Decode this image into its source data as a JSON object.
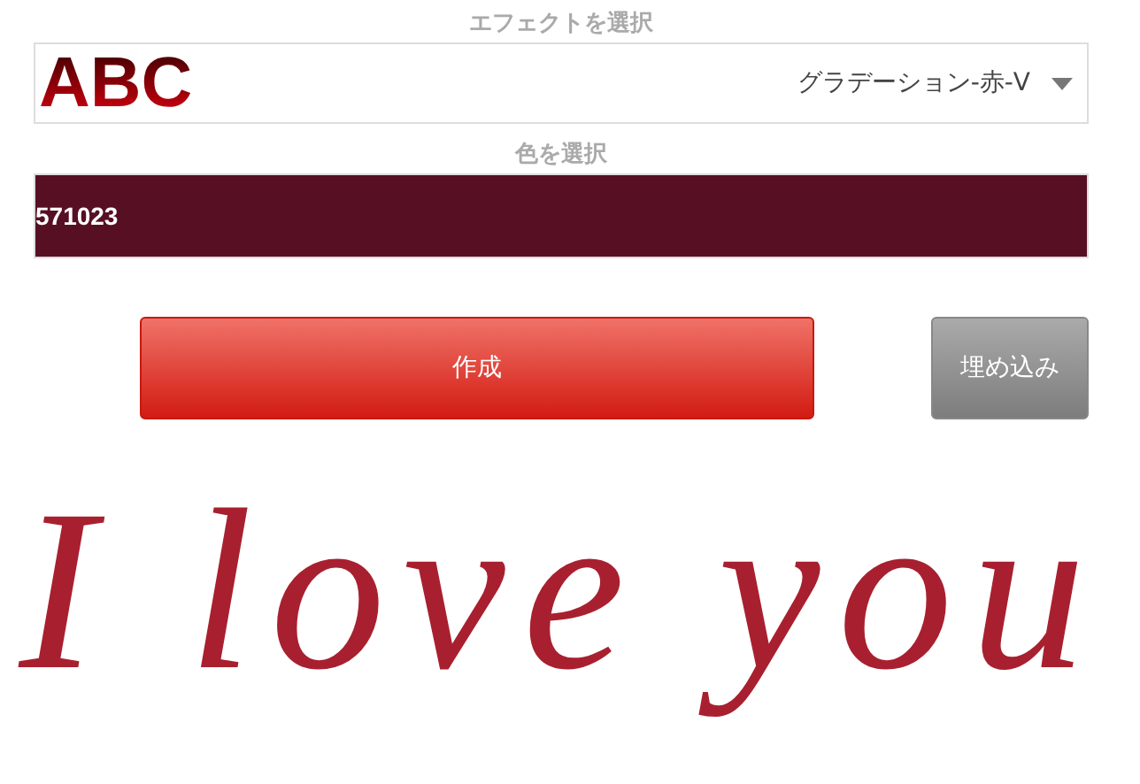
{
  "effect": {
    "label": "エフェクトを選択",
    "sample": "ABC",
    "value": "グラデーション-赤-V"
  },
  "color": {
    "label": "色を選択",
    "value": "571023",
    "color": "#571023"
  },
  "buttons": [
    {
      "kind": "primary",
      "label": "作成"
    },
    {
      "kind": "secondary",
      "label": "埋め込み"
    }
  ],
  "preview": {
    "text": "I love you"
  }
}
